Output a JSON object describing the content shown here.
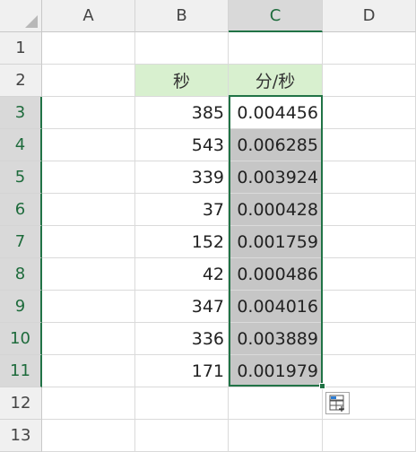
{
  "columns": [
    "A",
    "B",
    "C",
    "D"
  ],
  "rows": [
    "1",
    "2",
    "3",
    "4",
    "5",
    "6",
    "7",
    "8",
    "9",
    "10",
    "11",
    "12",
    "13"
  ],
  "header_row": {
    "b": "秒",
    "c": "分/秒"
  },
  "data": [
    {
      "seconds": "385",
      "minutes_per_second": "0.004456"
    },
    {
      "seconds": "543",
      "minutes_per_second": "0.006285"
    },
    {
      "seconds": "339",
      "minutes_per_second": "0.003924"
    },
    {
      "seconds": "37",
      "minutes_per_second": "0.000428"
    },
    {
      "seconds": "152",
      "minutes_per_second": "0.001759"
    },
    {
      "seconds": "42",
      "minutes_per_second": "0.000486"
    },
    {
      "seconds": "347",
      "minutes_per_second": "0.004016"
    },
    {
      "seconds": "336",
      "minutes_per_second": "0.003889"
    },
    {
      "seconds": "171",
      "minutes_per_second": "0.001979"
    }
  ],
  "selection": {
    "column": "C",
    "first_row": "3",
    "last_row": "11",
    "active_cell": "C3"
  },
  "colors": {
    "accent": "#217346",
    "header_fill": "#d8f0cf",
    "selection_fill": "#c6c6c6",
    "header_bg": "#f0f0f0"
  },
  "icons": {
    "quick_analysis": "quick-analysis-icon"
  }
}
